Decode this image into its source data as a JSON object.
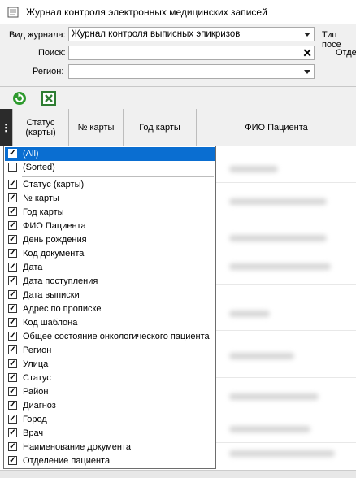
{
  "window": {
    "title": "Журнал контроля электронных медицинских записей",
    "icon": "journal-icon"
  },
  "filters": {
    "journal_type_label": "Вид журнала:",
    "journal_type_value": "Журнал контроля выписных эпикризов",
    "search_label": "Поиск:",
    "search_value": "",
    "region_label": "Регион:",
    "region_value": "",
    "post_type_label": "Тип посе",
    "department_label": "Отде"
  },
  "toolbar": {
    "refresh_icon": "refresh-icon",
    "export_icon": "excel-export-icon",
    "colors": {
      "refresh": "#2e9a2e",
      "export": "#2e7d32"
    }
  },
  "grid": {
    "columns": [
      "Статус (карты)",
      "№ карты",
      "Год карты",
      "ФИО Пациента"
    ]
  },
  "column_filter": {
    "items": [
      {
        "label": "(All)",
        "checked": true,
        "selected": true
      },
      {
        "label": "(Sorted)",
        "checked": false,
        "selected": false
      },
      {
        "label": "Статус (карты)",
        "checked": true
      },
      {
        "label": "№ карты",
        "checked": true
      },
      {
        "label": "Год карты",
        "checked": true
      },
      {
        "label": "ФИО Пациента",
        "checked": true
      },
      {
        "label": "День рождения",
        "checked": true
      },
      {
        "label": "Код документа",
        "checked": true
      },
      {
        "label": "Дата",
        "checked": true
      },
      {
        "label": "Дата поступления",
        "checked": true
      },
      {
        "label": "Дата выписки",
        "checked": true
      },
      {
        "label": "Адрес по прописке",
        "checked": true
      },
      {
        "label": "Код шаблона",
        "checked": true
      },
      {
        "label": "Общее состояние онкологического пациента",
        "checked": true
      },
      {
        "label": "Регион",
        "checked": true
      },
      {
        "label": "Улица",
        "checked": true
      },
      {
        "label": "Статус",
        "checked": true
      },
      {
        "label": "Район",
        "checked": true
      },
      {
        "label": "Диагноз",
        "checked": true
      },
      {
        "label": "Город",
        "checked": true
      },
      {
        "label": "Врач",
        "checked": true
      },
      {
        "label": "Наименование документа",
        "checked": true
      },
      {
        "label": "Отделение пациента",
        "checked": true
      }
    ]
  },
  "colors": {
    "selection": "#0a6ed1",
    "header_bg": "#f0f0f0"
  }
}
